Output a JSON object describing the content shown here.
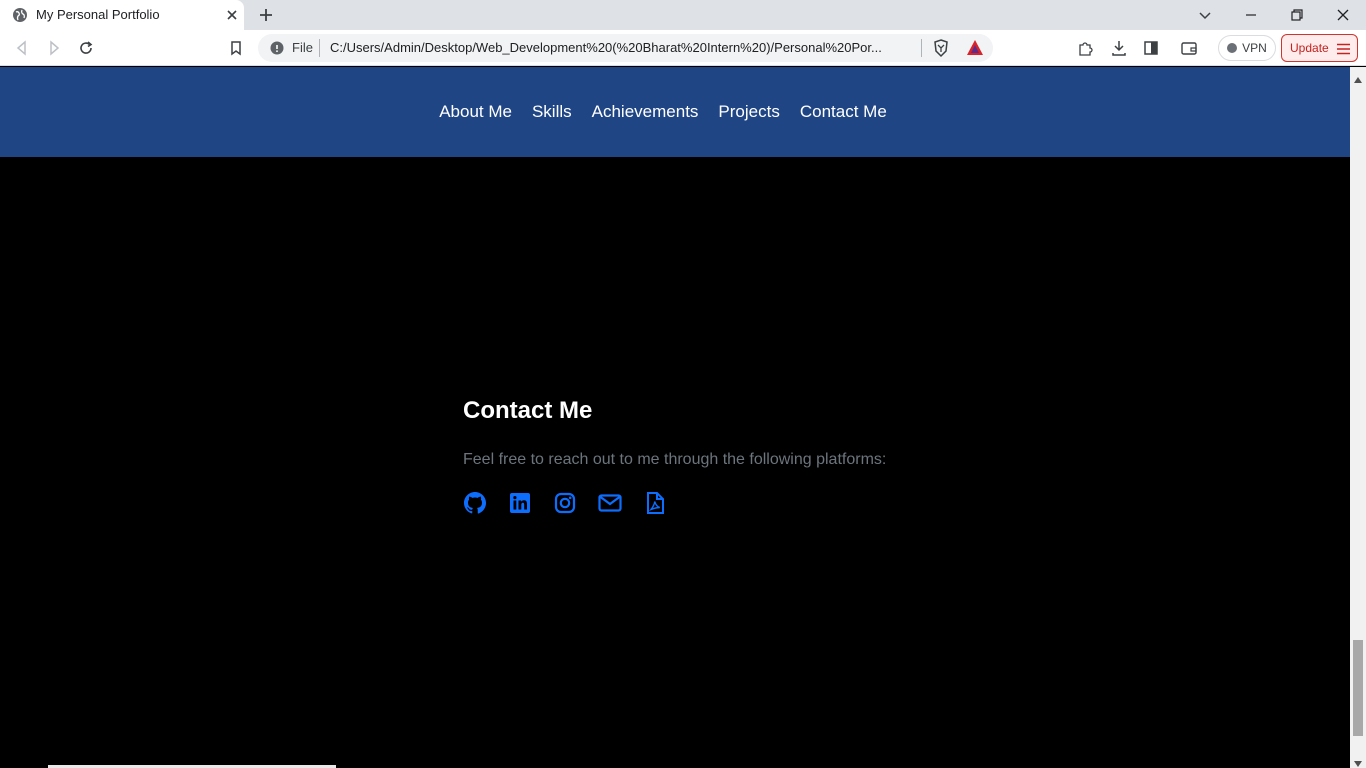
{
  "browser": {
    "tab_title": "My Personal Portfolio",
    "address_scheme_label": "File",
    "address_url": "C:/Users/Admin/Desktop/Web_Development%20(%20Bharat%20Intern%20)/Personal%20Por...",
    "vpn_label": "VPN",
    "update_label": "Update",
    "icons": [
      "globe-icon",
      "close-icon",
      "plus-icon",
      "chevron-down-icon",
      "minimize-icon",
      "restore-icon",
      "close-window-icon",
      "back-icon",
      "forward-icon",
      "reload-icon",
      "bookmark-icon",
      "info-icon",
      "brave-shield-icon",
      "brave-rewards-icon",
      "extensions-icon",
      "download-icon",
      "sidebar-icon",
      "wallet-icon",
      "hamburger-icon"
    ]
  },
  "nav": {
    "items": [
      {
        "label": "About Me"
      },
      {
        "label": "Skills"
      },
      {
        "label": "Achievements"
      },
      {
        "label": "Projects"
      },
      {
        "label": "Contact Me"
      }
    ],
    "background": "#1f4585"
  },
  "contact": {
    "heading": "Contact Me",
    "subtitle": "Feel free to reach out to me through the following platforms:",
    "icon_color": "#0d6efd",
    "links": [
      "github-icon",
      "linkedin-icon",
      "instagram-icon",
      "email-icon",
      "pdf-resume-icon"
    ]
  }
}
